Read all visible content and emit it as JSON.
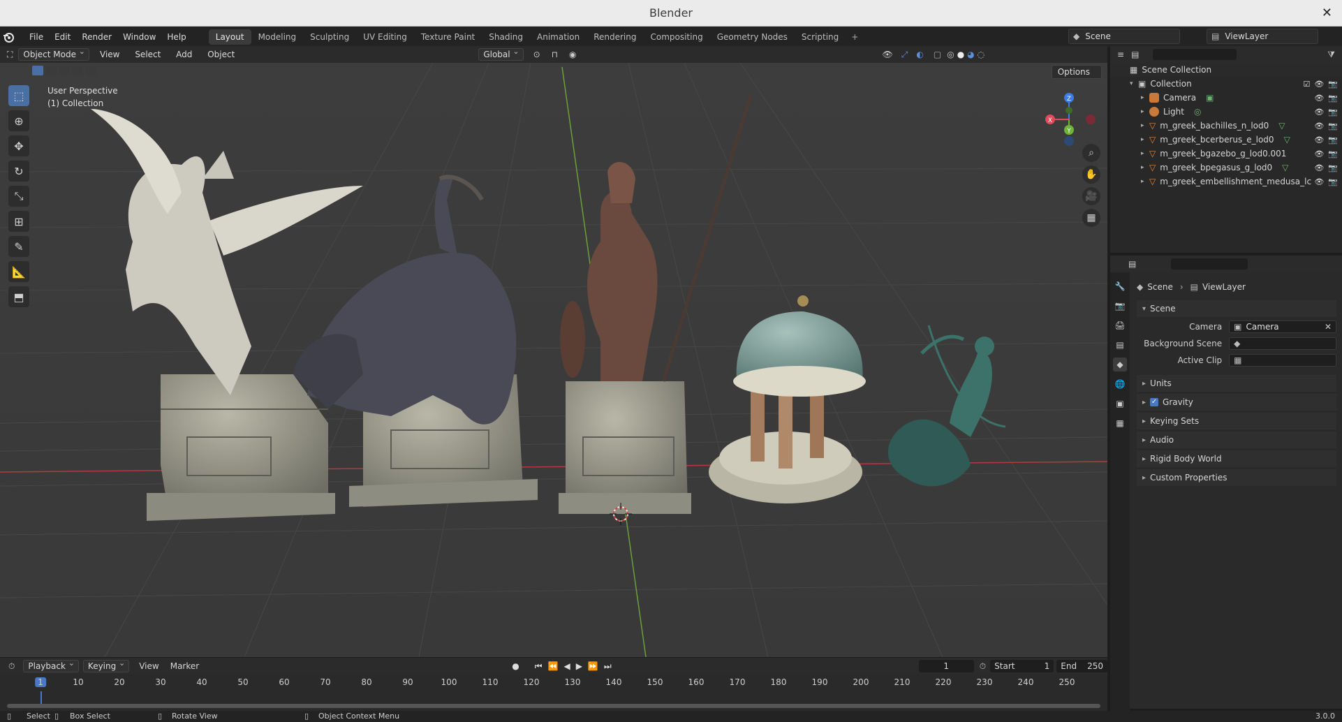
{
  "window": {
    "title": "Blender",
    "close_glyph": "✕"
  },
  "menu": [
    "File",
    "Edit",
    "Render",
    "Window",
    "Help"
  ],
  "workspaces": [
    "Layout",
    "Modeling",
    "Sculpting",
    "UV Editing",
    "Texture Paint",
    "Shading",
    "Animation",
    "Rendering",
    "Compositing",
    "Geometry Nodes",
    "Scripting"
  ],
  "active_workspace": "Layout",
  "scene_name": "Scene",
  "view_layer": "ViewLayer",
  "viewport": {
    "mode": "Object Mode",
    "menus": [
      "View",
      "Select",
      "Add",
      "Object"
    ],
    "orientation": "Global",
    "options_label": "Options",
    "perspective_label": "User Perspective",
    "collection_label": "(1) Collection",
    "gizmo_axes": [
      "Z",
      "Y",
      "X"
    ]
  },
  "outliner": {
    "root": "Scene Collection",
    "collection": "Collection",
    "items": [
      {
        "name": "Camera",
        "icon": "camera-icon"
      },
      {
        "name": "Light",
        "icon": "light-icon"
      },
      {
        "name": "m_greek_bachilles_n_lod0",
        "icon": "mesh-icon"
      },
      {
        "name": "m_greek_bcerberus_e_lod0",
        "icon": "mesh-icon"
      },
      {
        "name": "m_greek_bgazebo_g_lod0.001",
        "icon": "mesh-icon"
      },
      {
        "name": "m_greek_bpegasus_g_lod0",
        "icon": "mesh-icon"
      },
      {
        "name": "m_greek_embellishment_medusa_lc",
        "icon": "mesh-icon"
      }
    ]
  },
  "properties": {
    "breadcrumb_scene": "Scene",
    "breadcrumb_viewlayer": "ViewLayer",
    "panel_scene": "Scene",
    "camera_label": "Camera",
    "camera_value": "Camera",
    "background_scene_label": "Background Scene",
    "active_clip_label": "Active Clip",
    "panels": [
      "Units",
      "Gravity",
      "Keying Sets",
      "Audio",
      "Rigid Body World",
      "Custom Properties"
    ],
    "gravity_checked": true
  },
  "timeline": {
    "menus": [
      "Playback",
      "Keying",
      "View",
      "Marker"
    ],
    "current_frame": "1",
    "start_label": "Start",
    "start": "1",
    "end_label": "End",
    "end": "250",
    "ruler": [
      "10",
      "20",
      "30",
      "40",
      "50",
      "60",
      "70",
      "80",
      "90",
      "100",
      "110",
      "120",
      "130",
      "140",
      "150",
      "160",
      "170",
      "180",
      "190",
      "200",
      "210",
      "220",
      "230",
      "240",
      "250"
    ]
  },
  "status": {
    "select": "Select",
    "box_select": "Box Select",
    "rotate_view": "Rotate View",
    "context_menu": "Object Context Menu",
    "version": "3.0.0"
  },
  "colors": {
    "accent": "#4a78c9",
    "x_axis": "#e04a5a",
    "y_axis": "#6fb33a",
    "z_axis": "#3d7ce0"
  }
}
